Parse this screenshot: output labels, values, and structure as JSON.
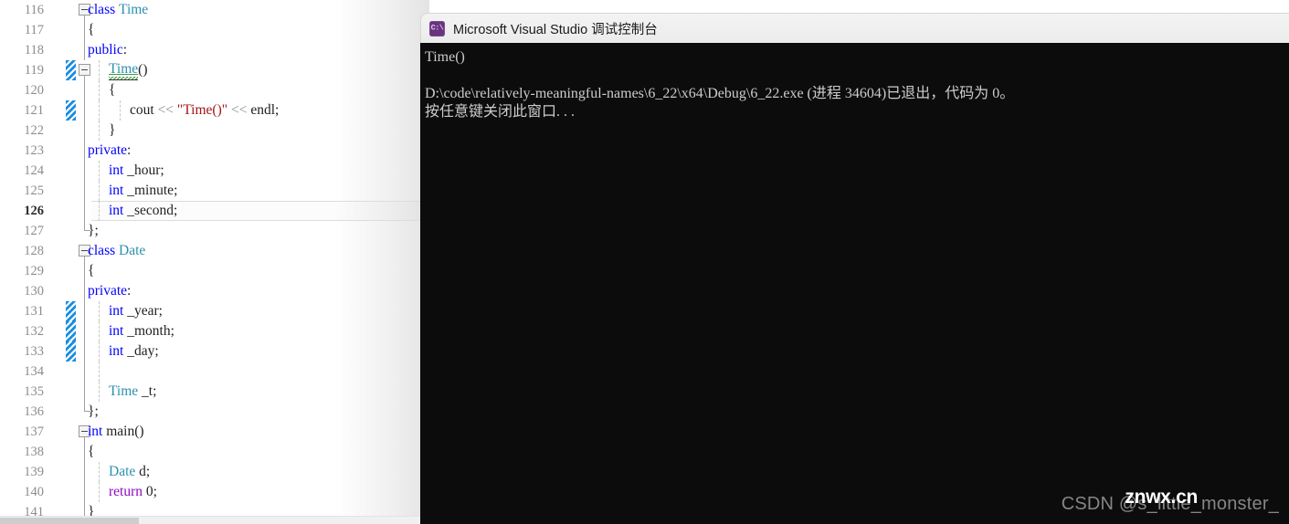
{
  "editor": {
    "name": "visual-studio-code-editor",
    "language": "cpp",
    "current_line": 126,
    "colors": {
      "keyword": "#0000ff",
      "keyword_control": "#8f08c4",
      "type": "#2b91af",
      "string": "#a31515",
      "operator": "#8a8a8a",
      "line_number": "#8c8c8c",
      "change_marker": "#1a8ee0",
      "squiggle": "#3f9b3f"
    },
    "lines": [
      {
        "num": "116",
        "indent": 0,
        "text": "class Time",
        "outline": "minus-open",
        "change": false,
        "guides": []
      },
      {
        "num": "117",
        "indent": 0,
        "text": "{",
        "outline": "line",
        "change": false,
        "guides": []
      },
      {
        "num": "118",
        "indent": 0,
        "text": "public:",
        "outline": "line",
        "change": false,
        "guides": []
      },
      {
        "num": "119",
        "indent": 1,
        "text": "Time()",
        "outline": "minus-open",
        "change": true,
        "guides": [
          "g1"
        ]
      },
      {
        "num": "120",
        "indent": 1,
        "text": "{",
        "outline": "line",
        "change": false,
        "guides": [
          "g1"
        ]
      },
      {
        "num": "121",
        "indent": 2,
        "text": "cout << \"Time()\" << endl;",
        "outline": "line",
        "change": true,
        "guides": [
          "g1",
          "g2"
        ]
      },
      {
        "num": "122",
        "indent": 1,
        "text": "}",
        "outline": "line",
        "change": false,
        "guides": [
          "g1"
        ]
      },
      {
        "num": "123",
        "indent": 0,
        "text": "private:",
        "outline": "line",
        "change": false,
        "guides": []
      },
      {
        "num": "124",
        "indent": 1,
        "text": "int _hour;",
        "outline": "line",
        "change": false,
        "guides": [
          "g1"
        ]
      },
      {
        "num": "125",
        "indent": 1,
        "text": "int _minute;",
        "outline": "line",
        "change": false,
        "guides": [
          "g1"
        ]
      },
      {
        "num": "126",
        "indent": 1,
        "text": "int _second;",
        "outline": "line",
        "change": false,
        "guides": [
          "g1"
        ]
      },
      {
        "num": "127",
        "indent": 0,
        "text": "};",
        "outline": "elbow",
        "change": false,
        "guides": []
      },
      {
        "num": "128",
        "indent": 0,
        "text": "class Date",
        "outline": "minus-open",
        "change": false,
        "guides": []
      },
      {
        "num": "129",
        "indent": 0,
        "text": "{",
        "outline": "line",
        "change": false,
        "guides": []
      },
      {
        "num": "130",
        "indent": 0,
        "text": "private:",
        "outline": "line",
        "change": false,
        "guides": []
      },
      {
        "num": "131",
        "indent": 1,
        "text": "int _year;",
        "outline": "line",
        "change": true,
        "guides": [
          "g1"
        ]
      },
      {
        "num": "132",
        "indent": 1,
        "text": "int _month;",
        "outline": "line",
        "change": true,
        "guides": [
          "g1"
        ]
      },
      {
        "num": "133",
        "indent": 1,
        "text": "int _day;",
        "outline": "line",
        "change": true,
        "guides": [
          "g1"
        ]
      },
      {
        "num": "134",
        "indent": 1,
        "text": "",
        "outline": "line",
        "change": false,
        "guides": [
          "g1"
        ]
      },
      {
        "num": "135",
        "indent": 1,
        "text": "Time _t;",
        "outline": "line",
        "change": false,
        "guides": [
          "g1"
        ]
      },
      {
        "num": "136",
        "indent": 0,
        "text": "};",
        "outline": "elbow",
        "change": false,
        "guides": []
      },
      {
        "num": "137",
        "indent": 0,
        "text": "int main()",
        "outline": "minus-open",
        "change": false,
        "guides": []
      },
      {
        "num": "138",
        "indent": 0,
        "text": "{",
        "outline": "line",
        "change": false,
        "guides": []
      },
      {
        "num": "139",
        "indent": 1,
        "text": "Date d;",
        "outline": "line",
        "change": false,
        "guides": [
          "g1"
        ]
      },
      {
        "num": "140",
        "indent": 1,
        "text": "return 0;",
        "outline": "line",
        "change": false,
        "guides": [
          "g1"
        ]
      },
      {
        "num": "141",
        "indent": 0,
        "text": "}",
        "outline": "line",
        "change": false,
        "guides": []
      }
    ]
  },
  "console": {
    "name": "visual-studio-debug-console",
    "icon": "cmd-prompt-icon",
    "icon_text": "C:\\",
    "title": "Microsoft Visual Studio 调试控制台",
    "background": "#0c0c0c",
    "foreground": "#cccccc",
    "output": [
      "Time()",
      "",
      "D:\\code\\relatively-meaningful-names\\6_22\\x64\\Debug\\6_22.exe (进程 34604)已退出，代码为 0。",
      "按任意键关闭此窗口. . ."
    ]
  },
  "watermarks": {
    "csdn": "CSDN @s_little_monster_",
    "site": "znwx.cn"
  }
}
